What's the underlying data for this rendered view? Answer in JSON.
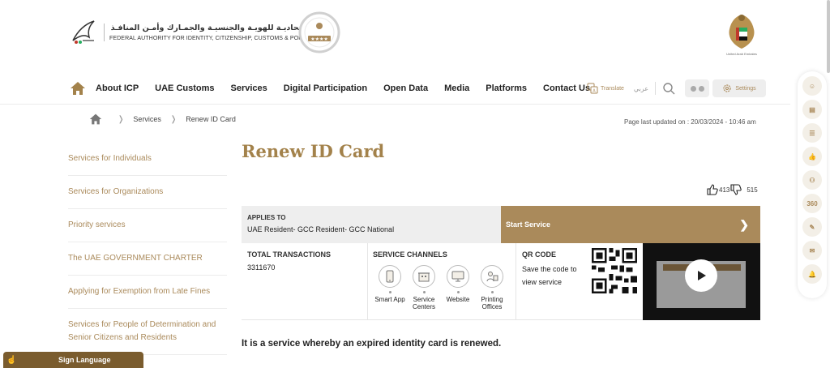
{
  "header": {
    "org_name_ar": "الهيئـة الاتحاديـة للهويـة والجنسيـة والجمـارك وأمـن المنافـذ",
    "org_name_en": "FEDERAL AUTHORITY FOR IDENTITY, CITIZENSHIP, CUSTOMS & PORT SECURITY",
    "emblem_caption": "United Arab Emirates"
  },
  "nav": {
    "items": [
      "About ICP",
      "UAE Customs",
      "Services",
      "Digital Participation",
      "Open Data",
      "Media",
      "Platforms",
      "Contact Us"
    ],
    "translate_label": "Translate",
    "arabic_label": "عربي",
    "settings_label": "Settings"
  },
  "breadcrumb": {
    "items": [
      "Services",
      "Renew ID Card"
    ],
    "last_updated": "Page last updated on : 20/03/2024 - 10:46 am"
  },
  "sidebar": {
    "items": [
      "Services for Individuals",
      "Services for Organizations",
      "Priority services",
      "The UAE GOVERNMENT CHARTER",
      "Applying for Exemption from Late Fines",
      "Services for People of Determination and Senior Citizens and Residents"
    ]
  },
  "main": {
    "title": "Renew ID Card",
    "likes": "413",
    "dislikes": "515",
    "applies_to_label": "APPLIES TO",
    "applies_to_value": "UAE Resident- GCC Resident- GCC National",
    "start_service_label": "Start Service",
    "total_transactions_label": "TOTAL TRANSACTIONS",
    "total_transactions_value": "3311670",
    "service_channels_label": "SERVICE CHANNELS",
    "channels": [
      "Smart App",
      "Service Centers",
      "Website",
      "Printing Offices"
    ],
    "qr_label": "QR CODE",
    "qr_desc": "Save the code to view service",
    "description": "It is a service whereby an expired identity card is renewed."
  },
  "sign_language": {
    "label": "Sign Language"
  },
  "side_panel": {
    "badge_360": "360"
  },
  "colors": {
    "accent": "#aa8a5b",
    "title": "#a3824b",
    "sign_bar": "#7a5c2e"
  }
}
